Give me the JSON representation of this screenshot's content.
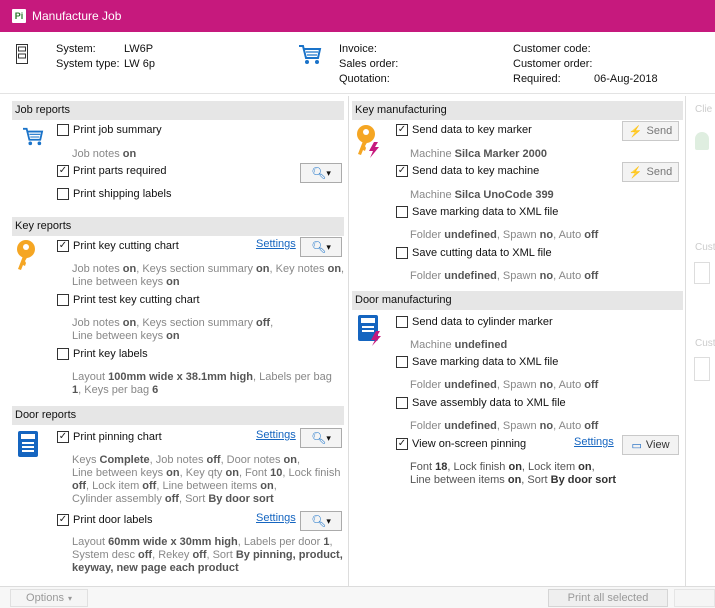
{
  "window": {
    "title": "Manufacture Job"
  },
  "header": {
    "system_label": "System:",
    "system_value": "LW6P",
    "type_label": "System type:",
    "type_value": "LW 6p",
    "invoice_label": "Invoice:",
    "sales_label": "Sales order:",
    "quotation_label": "Quotation:",
    "customer_code_label": "Customer code:",
    "customer_order_label": "Customer order:",
    "required_label": "Required:",
    "required_value": "06-Aug-2018"
  },
  "job_reports": {
    "title": "Job reports",
    "items": [
      {
        "label": "Print job summary",
        "checked": false,
        "note": "Job notes on"
      },
      {
        "label": "Print parts required",
        "checked": true
      },
      {
        "label": "Print shipping labels",
        "checked": false
      }
    ]
  },
  "key_reports": {
    "title": "Key reports",
    "items": [
      {
        "label": "Print key cutting chart",
        "checked": true,
        "settings": "Settings",
        "note1": "Job notes on, Keys section summary on, Key notes on,",
        "note2": "Line between keys on"
      },
      {
        "label": "Print test key cutting chart",
        "checked": false,
        "note1": "Job notes on, Keys section summary off,",
        "note2": "Line between keys on"
      },
      {
        "label": "Print key labels",
        "checked": false,
        "note1": "Layout 100mm wide x 38.1mm high, Labels per bag",
        "note2": "1, Keys per bag 6"
      }
    ]
  },
  "door_reports": {
    "title": "Door reports",
    "items": [
      {
        "label": "Print pinning chart",
        "checked": true,
        "settings": "Settings",
        "note1": "Keys Complete, Job notes off, Door notes on,",
        "note2": "Line between keys on, Key qty on, Font 10, Lock finish",
        "note3": "off, Lock item off, Line between items on,",
        "note4": "Cylinder assembly off, Sort By door sort"
      },
      {
        "label": "Print door labels",
        "checked": true,
        "settings": "Settings",
        "note1": "Layout 60mm wide x 30mm high, Labels per door 1,",
        "note2": "System desc off, Rekey off, Sort By pinning, product,",
        "note3": "keyway, new page each product"
      }
    ]
  },
  "key_manufacturing": {
    "title": "Key manufacturing",
    "items": [
      {
        "label": "Send data to key marker",
        "checked": true,
        "button": "Send",
        "note": "Machine Silca Marker 2000"
      },
      {
        "label": "Send data to key machine",
        "checked": true,
        "button": "Send",
        "note": "Machine Silca UnoCode 399"
      },
      {
        "label": "Save marking data to XML file",
        "checked": false,
        "note": "Folder undefined, Spawn no, Auto off"
      },
      {
        "label": "Save cutting data to XML file",
        "checked": false,
        "note": "Folder undefined, Spawn no, Auto off"
      }
    ]
  },
  "door_manufacturing": {
    "title": "Door manufacturing",
    "items": [
      {
        "label": "Send data to cylinder marker",
        "checked": false,
        "note": "Machine undefined"
      },
      {
        "label": "Save marking data to XML file",
        "checked": false,
        "note": "Folder undefined, Spawn no, Auto off"
      },
      {
        "label": "Save assembly data to XML file",
        "checked": false,
        "note": "Folder undefined, Spawn no, Auto off"
      },
      {
        "label": "View on-screen pinning",
        "checked": true,
        "settings": "Settings",
        "button": "View",
        "note1": "Font 18, Lock finish on, Lock item on,",
        "note2": "Line between items on, Sort By door sort"
      }
    ]
  },
  "side": {
    "c1": "Clie",
    "c2": "Cust",
    "c3": "Cust"
  },
  "footer": {
    "options": "Options",
    "print_all": "Print all selected"
  },
  "colors": {
    "title_bar": "#c6197d",
    "section_bg": "#e6e6e6",
    "link": "#1565c0"
  }
}
